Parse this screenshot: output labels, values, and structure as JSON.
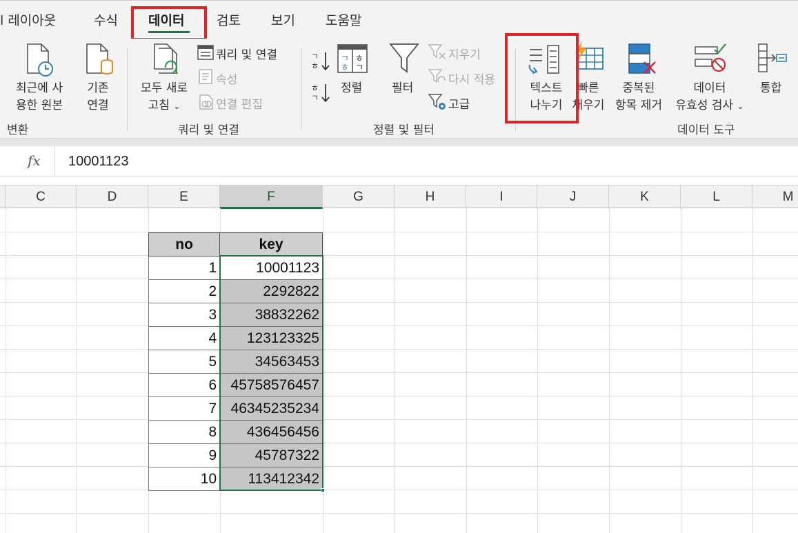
{
  "tabs": [
    {
      "label": "l 레이아웃"
    },
    {
      "label": "수식"
    },
    {
      "label": "데이터",
      "active": true
    },
    {
      "label": "검토"
    },
    {
      "label": "보기"
    },
    {
      "label": "도움말"
    }
  ],
  "ribbon": {
    "transform": {
      "recent_sources": [
        "최근에 사",
        "용한 원본"
      ],
      "existing_connections": [
        "기존",
        "연결"
      ],
      "group_label": "변환"
    },
    "queries": {
      "refresh_all": [
        "모두 새로",
        "고침"
      ],
      "queries_connections": "쿼리 및 연결",
      "properties": "속성",
      "edit_links": "연결 편집",
      "group_label": "쿼리 및 연결"
    },
    "sort_filter": {
      "sort": "정렬",
      "filter": "필터",
      "clear": "지우기",
      "reapply": "다시 적용",
      "advanced": "고급",
      "group_label": "정렬 및 필터"
    },
    "data_tools": {
      "text_to_columns": [
        "텍스트",
        "나누기"
      ],
      "flash_fill": [
        "빠른",
        "채우기"
      ],
      "remove_duplicates": [
        "중복된",
        "항목 제거"
      ],
      "data_validation": [
        "데이터",
        "유효성 검사"
      ],
      "consolidate": "통합",
      "group_label": "데이터 도구"
    }
  },
  "formula_bar": {
    "fx": "fx",
    "value": "10001123"
  },
  "columns": [
    "C",
    "D",
    "E",
    "F",
    "G",
    "H",
    "I",
    "J",
    "K",
    "L",
    "M"
  ],
  "selected_column": "F",
  "table": {
    "headers": {
      "no": "no",
      "key": "key"
    },
    "rows": [
      {
        "no": "1",
        "key": "10001123"
      },
      {
        "no": "2",
        "key": "2292822"
      },
      {
        "no": "3",
        "key": "38832262"
      },
      {
        "no": "4",
        "key": "123123325"
      },
      {
        "no": "5",
        "key": "34563453"
      },
      {
        "no": "6",
        "key": "45758576457"
      },
      {
        "no": "7",
        "key": "46345235234"
      },
      {
        "no": "8",
        "key": "436456456"
      },
      {
        "no": "9",
        "key": "45787322"
      },
      {
        "no": "10",
        "key": "113412342"
      }
    ]
  },
  "colors": {
    "accent_green": "#217346",
    "highlight_red": "#e0232b",
    "icon_blue": "#2f7fc1"
  }
}
